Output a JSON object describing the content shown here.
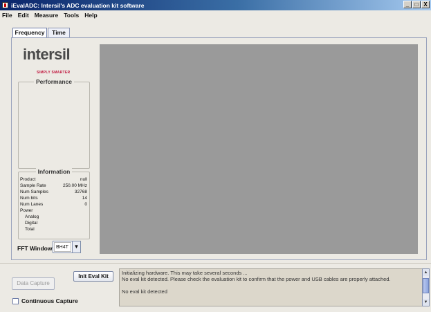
{
  "window": {
    "title": "iEvalADC: Intersil's ADC evaluation kit software",
    "minimize": "_",
    "maximize": "□",
    "close": "X"
  },
  "menu": [
    "File",
    "Edit",
    "Measure",
    "Tools",
    "Help"
  ],
  "tabs": [
    {
      "label": "Frequency",
      "active": true
    },
    {
      "label": "Time",
      "active": false
    }
  ],
  "logo": {
    "text": "intersil",
    "tagline": "SIMPLY SMARTER"
  },
  "performance": {
    "title": "Performance"
  },
  "information": {
    "title": "Information",
    "rows": [
      {
        "label": "Product",
        "value": "null"
      },
      {
        "label": "Sample Rate",
        "value": "250.00 MHz"
      },
      {
        "label": "Num Samples",
        "value": "32768"
      },
      {
        "label": "Num bits",
        "value": "14"
      },
      {
        "label": "Num Lanes",
        "value": "0"
      },
      {
        "label": "Power",
        "value": ""
      },
      {
        "label": "Analog",
        "value": ""
      },
      {
        "label": "Digital",
        "value": ""
      },
      {
        "label": "Total",
        "value": ""
      }
    ]
  },
  "fft": {
    "label": "FFT Window",
    "selected": "BH4T",
    "arrow": "▼"
  },
  "buttons": {
    "init": "Init Eval Kit",
    "capture": "Data Capture"
  },
  "continuous_capture": {
    "label": "Continuous Capture",
    "checked": false
  },
  "log": [
    "Initializing hardware.  This may take several seconds ...",
    "No eval kit detected.  Please check the evaluation kit to confirm that the power and USB cables are properly attached.",
    "",
    "No eval kit detected"
  ],
  "scroll": {
    "up": "▲",
    "down": "▼"
  },
  "colors": {
    "plot_background": "#9a9a9a",
    "title_bar_start": "#0a246a",
    "logo_accent": "#c0143c"
  }
}
